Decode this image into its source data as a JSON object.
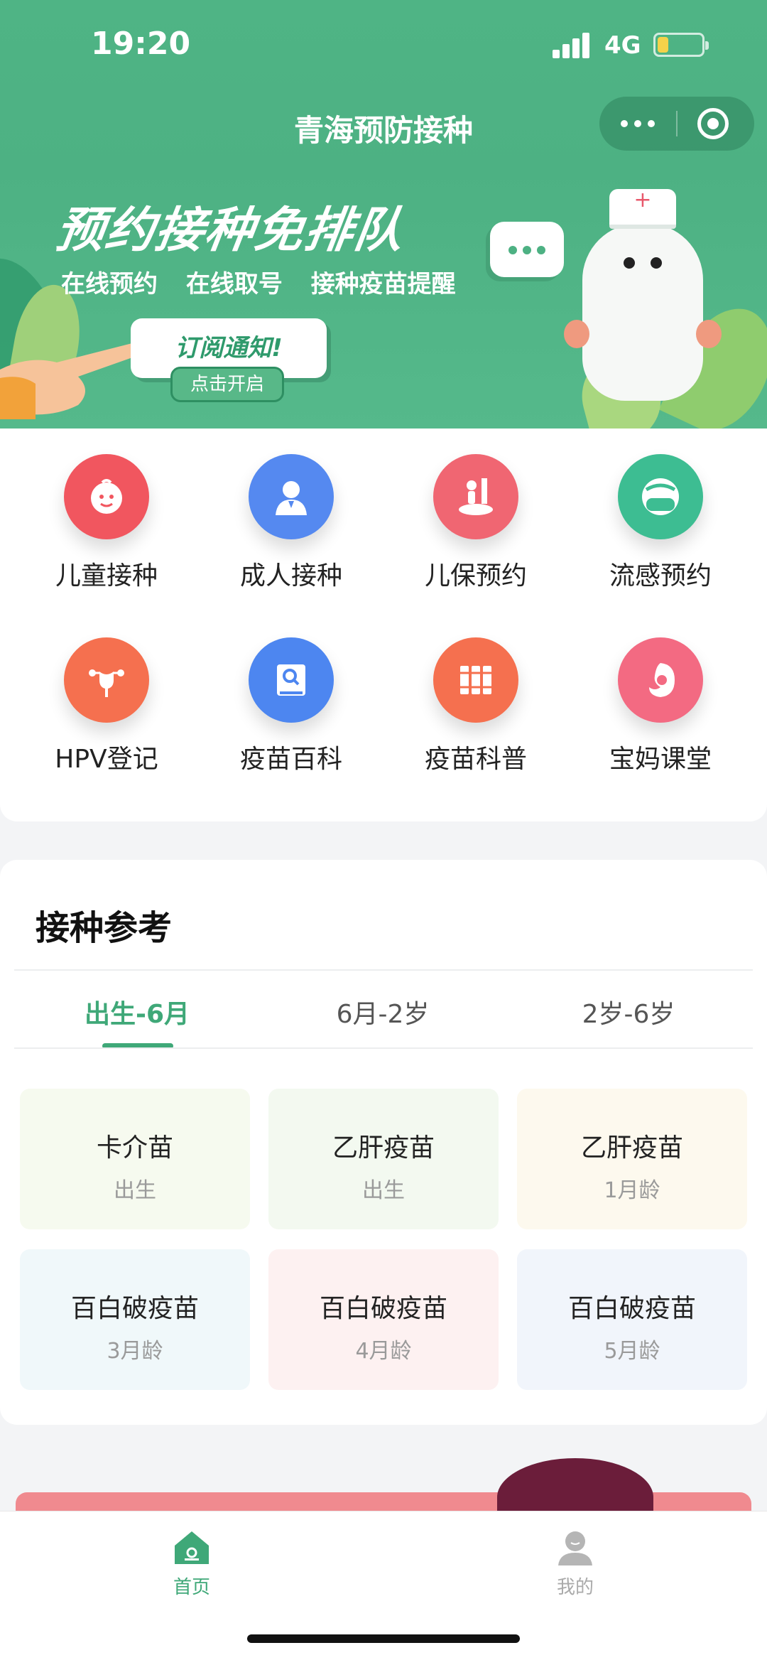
{
  "status_bar": {
    "time": "19:20",
    "network": "4G",
    "battery_level": 0.25
  },
  "nav": {
    "title": "青海预防接种"
  },
  "banner": {
    "headline": "预约接种免排队",
    "features": [
      "在线预约",
      "在线取号",
      "接种疫苗提醒"
    ],
    "subscribe_title": "订阅通知!",
    "subscribe_action": "点击开启"
  },
  "services": [
    {
      "label": "儿童接种",
      "icon": "child-face-icon",
      "color": "#f1565f"
    },
    {
      "label": "成人接种",
      "icon": "adult-person-icon",
      "color": "#5589f0"
    },
    {
      "label": "儿保预约",
      "icon": "child-height-icon",
      "color": "#f06672"
    },
    {
      "label": "流感预约",
      "icon": "mask-face-icon",
      "color": "#3dbd92"
    },
    {
      "label": "HPV登记",
      "icon": "uterus-icon",
      "color": "#f5704f"
    },
    {
      "label": "疫苗百科",
      "icon": "book-search-icon",
      "color": "#4d86f0"
    },
    {
      "label": "疫苗科普",
      "icon": "books-icon",
      "color": "#f5704f"
    },
    {
      "label": "宝妈课堂",
      "icon": "mother-baby-icon",
      "color": "#f36a82"
    }
  ],
  "reference": {
    "title": "接种参考",
    "tabs": [
      "出生-6月",
      "6月-2岁",
      "2岁-6岁"
    ],
    "active_tab": 0,
    "vaccines": [
      {
        "name": "卡介苗",
        "age": "出生",
        "bg": "#f6faef"
      },
      {
        "name": "乙肝疫苗",
        "age": "出生",
        "bg": "#f3f9f0"
      },
      {
        "name": "乙肝疫苗",
        "age": "1月龄",
        "bg": "#fdf9ee"
      },
      {
        "name": "百白破疫苗",
        "age": "3月龄",
        "bg": "#f0f8fa"
      },
      {
        "name": "百白破疫苗",
        "age": "4月龄",
        "bg": "#fdf1f1"
      },
      {
        "name": "百白破疫苗",
        "age": "5月龄",
        "bg": "#f1f5fb"
      }
    ]
  },
  "tabbar": {
    "items": [
      {
        "label": "首页",
        "icon": "home-icon",
        "active": true
      },
      {
        "label": "我的",
        "icon": "profile-icon",
        "active": false
      }
    ]
  },
  "colors": {
    "primary": "#4db183",
    "tab_active": "#3fa878",
    "tab_inactive": "#aaaaaa"
  }
}
